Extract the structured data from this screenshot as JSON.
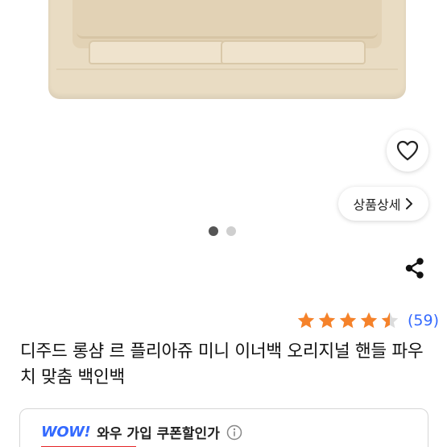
{
  "product": {
    "title": "디주드 롱샴 르 플리아쥬 미니 이너백 오리지널 핸들 파우치 맞춤 백인백",
    "rating_value": 4.5,
    "review_count": "(59)"
  },
  "gallery": {
    "detail_button_label": "상품상세",
    "dots_total": 2,
    "active_dot": 1
  },
  "wow": {
    "logo": "WOW!",
    "coupon_label": "와우 가입 쿠폰할인가"
  },
  "icons": {
    "wishlist": "heart-outline-icon",
    "detail": "chevron-right-icon",
    "share": "share-icon",
    "info": "info-circle-icon"
  },
  "colors": {
    "star": "#f5822a",
    "link_blue": "#346aff",
    "wow_red": "#e52528",
    "felt": "#e9dcc3"
  }
}
